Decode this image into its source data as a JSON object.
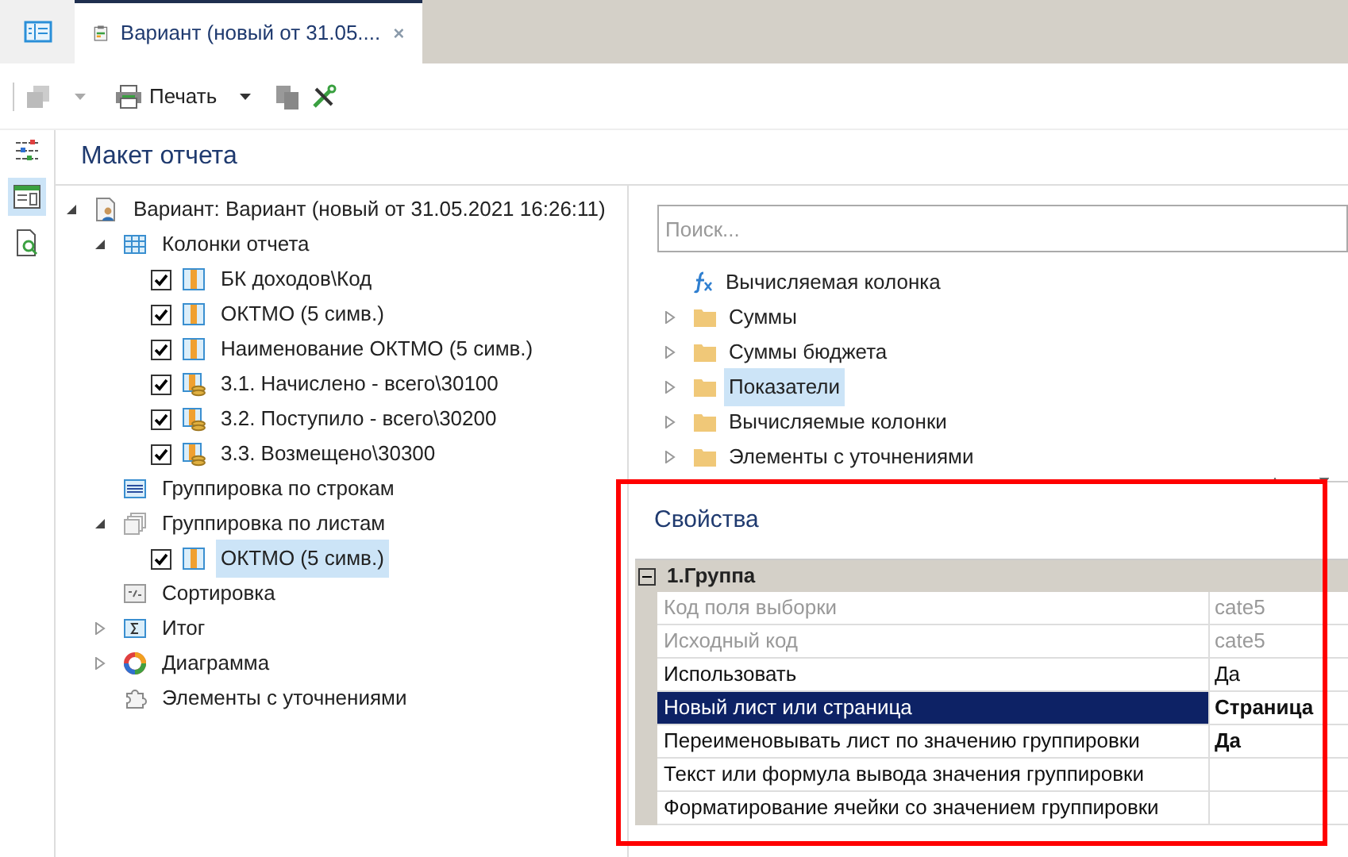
{
  "tabs": [
    {
      "label": "Вариант (новый от 31.05....",
      "selected": true,
      "closable": true
    }
  ],
  "toolbar": {
    "print": "Печать"
  },
  "panel_title": "Макет отчета",
  "tree": [
    {
      "label": "Вариант: Вариант (новый от 31.05.2021 16:26:11)",
      "kind": "variant",
      "expanded": true,
      "selected": false,
      "children": [
        {
          "label": "Колонки отчета",
          "kind": "columns",
          "expanded": true,
          "selected": false,
          "children": [
            {
              "label": "БК доходов\\Код",
              "kind": "column",
              "checked": true,
              "selected": false
            },
            {
              "label": "ОКТМО (5 симв.)",
              "kind": "column",
              "checked": true,
              "selected": false
            },
            {
              "label": "Наименование ОКТМО (5 симв.)",
              "kind": "column",
              "checked": true,
              "selected": false
            },
            {
              "label": "3.1. Начислено - всего\\30100",
              "kind": "sum",
              "checked": true,
              "selected": false
            },
            {
              "label": "3.2. Поступило - всего\\30200",
              "kind": "sum",
              "checked": true,
              "selected": false
            },
            {
              "label": "3.3. Возмещено\\30300",
              "kind": "sum",
              "checked": true,
              "selected": false
            }
          ]
        },
        {
          "label": "Группировка по строкам",
          "kind": "rows",
          "selected": false
        },
        {
          "label": "Группировка по листам",
          "kind": "sheets",
          "expanded": true,
          "selected": false,
          "children": [
            {
              "label": "ОКТМО (5 симв.)",
              "kind": "column",
              "checked": true,
              "selected": true
            }
          ]
        },
        {
          "label": "Сортировка",
          "kind": "sort",
          "selected": false
        },
        {
          "label": "Итог",
          "kind": "total",
          "expanded": false,
          "selected": false
        },
        {
          "label": "Диаграмма",
          "kind": "chart",
          "expanded": false,
          "selected": false
        },
        {
          "label": "Элементы с уточнениями",
          "kind": "puzzle",
          "selected": false
        }
      ]
    }
  ],
  "search": {
    "placeholder": "Поиск..."
  },
  "fields": [
    {
      "label": "Вычисляемая колонка",
      "kind": "formula",
      "selected": false
    },
    {
      "label": "Суммы",
      "kind": "folder",
      "expanded": false,
      "selected": false
    },
    {
      "label": "Суммы бюджета",
      "kind": "folder",
      "expanded": false,
      "selected": false
    },
    {
      "label": "Показатели",
      "kind": "folder",
      "expanded": false,
      "selected": true
    },
    {
      "label": "Вычисляемые колонки",
      "kind": "folder",
      "expanded": false,
      "selected": false
    },
    {
      "label": "Элементы с уточнениями",
      "kind": "folder",
      "expanded": false,
      "selected": false
    }
  ],
  "properties": {
    "title": "Свойства",
    "group": {
      "label": "1.Группа",
      "expanded": true
    },
    "rows": [
      {
        "label": "Код поля выборки",
        "value": "cate5",
        "disabled": true,
        "selected": false,
        "modified": false
      },
      {
        "label": "Исходный код",
        "value": "cate5",
        "disabled": true,
        "selected": false,
        "modified": false
      },
      {
        "label": "Использовать",
        "value": "Да",
        "disabled": false,
        "selected": false,
        "modified": false
      },
      {
        "label": "Новый лист или страница",
        "value": "Страница",
        "disabled": false,
        "selected": true,
        "modified": true
      },
      {
        "label": "Переименовывать лист по значению группировки",
        "value": "Да",
        "disabled": false,
        "selected": false,
        "modified": true
      },
      {
        "label": "Текст или формула вывода значения группировки",
        "disabled": false,
        "selected": false,
        "modified": false
      },
      {
        "label": "Форматирование ячейки со значением группировки",
        "disabled": false,
        "selected": false,
        "modified": false
      }
    ]
  }
}
